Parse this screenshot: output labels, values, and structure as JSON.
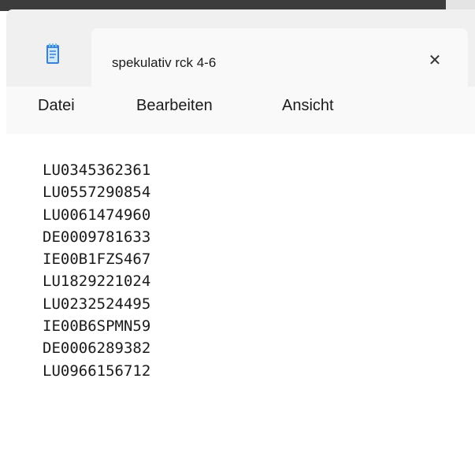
{
  "window": {
    "tab_title": "spekulativ rck 4-6",
    "icon": "notepad-icon",
    "close_glyph": "✕"
  },
  "menu": {
    "items": [
      "Datei",
      "Bearbeiten",
      "Ansicht"
    ]
  },
  "document": {
    "lines": [
      "LU0345362361",
      "LU0557290854",
      "LU0061474960",
      "DE0009781633",
      "IE00B1FZS467",
      "LU1829221024",
      "LU0232524495",
      "IE00B6SPMN59",
      "DE0006289382",
      "LU0966156712"
    ]
  },
  "colors": {
    "titlebar_bg": "#f1f0f0",
    "tab_bg": "#f9f9f9",
    "text": "#1b1b1b",
    "icon_blue": "#3a7fd9",
    "icon_accent": "#6ec1e4"
  }
}
